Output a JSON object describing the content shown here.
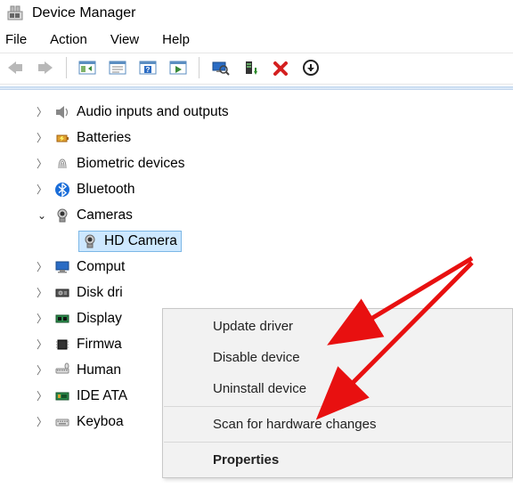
{
  "window": {
    "title": "Device Manager"
  },
  "menu": {
    "file": "File",
    "action": "Action",
    "view": "View",
    "help": "Help"
  },
  "tree": {
    "audio": "Audio inputs and outputs",
    "batteries": "Batteries",
    "biometric": "Biometric devices",
    "bluetooth": "Bluetooth",
    "cameras": "Cameras",
    "hdcamera": "HD Camera",
    "computer": "Comput",
    "diskdrives": "Disk dri",
    "display": "Display",
    "firmware": "Firmwa",
    "hid": "Human",
    "ide": "IDE ATA",
    "keyboards": "Keyboa"
  },
  "context_menu": {
    "update": "Update driver",
    "disable": "Disable device",
    "uninstall": "Uninstall device",
    "scan": "Scan for hardware changes",
    "properties": "Properties"
  }
}
